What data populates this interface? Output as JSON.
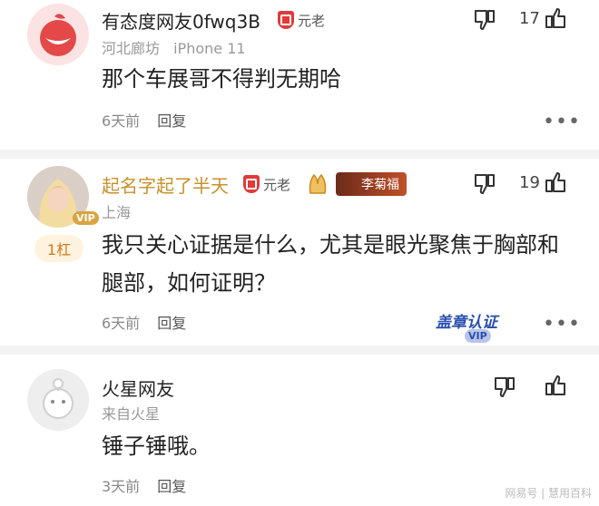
{
  "comments": [
    {
      "username": "有态度网友0fwq3B",
      "badge": "元老",
      "location": "河北廊坊",
      "device": "iPhone 11",
      "text": "那个车展哥不得判无期哈",
      "time": "6天前",
      "reply_label": "回复",
      "likes": "17"
    },
    {
      "username": "起名字起了半天",
      "badge": "元老",
      "name_card": "李菊福",
      "location": "上海",
      "floor_tag": "1杠",
      "avatar_badge": "VIP",
      "text": "我只关心证据是什么，尤其是眼光聚焦于胸部和腿部，如何证明？",
      "time": "6天前",
      "reply_label": "回复",
      "likes": "19",
      "stamp": "盖章认证",
      "stamp_vip": "VIP"
    },
    {
      "username": "火星网友",
      "location": "来自火星",
      "text": "锤子锤哦。",
      "time": "3天前",
      "reply_label": "回复",
      "likes": ""
    }
  ],
  "watermark": "网易号 | 慧用百科",
  "colors": {
    "accent_red": "#e03a3a",
    "gold_name": "#c8902a",
    "stamp_blue": "#2a4fb0"
  }
}
